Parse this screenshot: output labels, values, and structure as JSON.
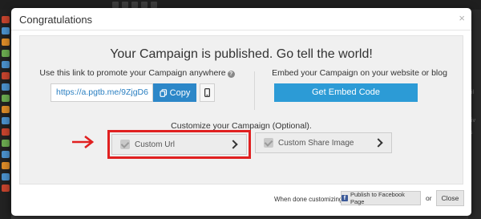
{
  "modal": {
    "title": "Congratulations",
    "close_glyph": "×",
    "headline": "Your Campaign is published. Go tell the world!"
  },
  "share_link": {
    "label": "Use this link to promote your Campaign anywhere",
    "help_glyph": "?",
    "url": "https://a.pgtb.me/9ZjgD6",
    "copy_label": "Copy",
    "copy_icon": "copy-icon",
    "phone_icon": "mobile-phone-icon"
  },
  "embed": {
    "label": "Embed your Campaign on your website or blog",
    "button_label": "Get Embed Code"
  },
  "customize": {
    "label": "Customize your Campaign (Optional).",
    "options": [
      {
        "label": "Custom Url"
      },
      {
        "label": "Custom Share Image"
      }
    ]
  },
  "footer": {
    "note": "When done customizing",
    "facebook_label": "Publish to Facebook Page",
    "facebook_glyph": "f",
    "or_label": "or",
    "close_label": "Close"
  },
  "background": {
    "right_fragments": [
      "ail",
      "Liv",
      "ts"
    ]
  },
  "colors": {
    "primary_button": "#2c87c8",
    "embed_button": "#2c9bd6",
    "highlight": "#e02020",
    "link_text": "#2a7fc1",
    "facebook": "#3b5998"
  }
}
